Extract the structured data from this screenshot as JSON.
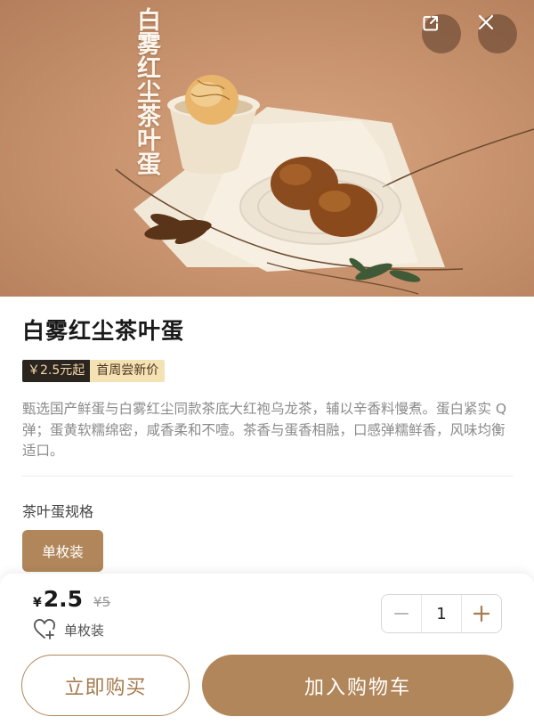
{
  "hero": {
    "overlay_title": "白雾红尘茶叶蛋",
    "share_icon": "share-icon",
    "close_icon": "close-icon"
  },
  "product": {
    "title": "白雾红尘茶叶蛋",
    "promo_price": "￥2.5元起",
    "promo_label": "首周尝新价",
    "description": "甄选国产鲜蛋与白雾红尘同款茶底大红袍乌龙茶，辅以辛香料慢煮。蛋白紧实 Q 弹；蛋黄软糯绵密，咸香柔和不噎。茶香与蛋香相融，口感弹糯鲜香，风味均衡适口。"
  },
  "spec": {
    "label": "茶叶蛋规格",
    "options": [
      "单枚装"
    ],
    "selected": "单枚装"
  },
  "bottom_bar": {
    "currency": "¥",
    "price": "2.5",
    "original_price": "¥5",
    "selected_spec": "单枚装",
    "quantity": "1",
    "buy_now": "立即购买",
    "add_to_cart": "加入购物车"
  },
  "colors": {
    "accent": "#b1865a",
    "promo_dark": "#2b2520",
    "promo_light": "#f5e2b4"
  }
}
